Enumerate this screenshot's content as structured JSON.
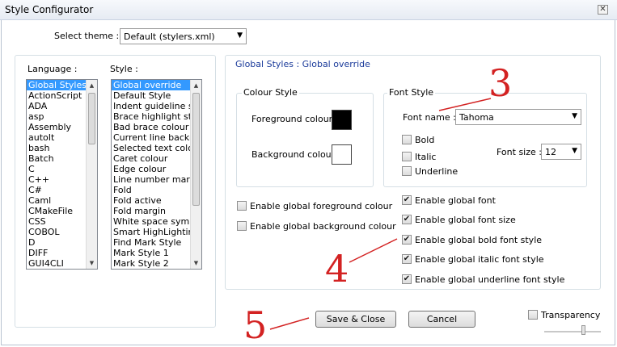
{
  "window": {
    "title": "Style Configurator",
    "close_icon": "close-icon"
  },
  "theme": {
    "label": "Select theme :",
    "value": "Default (stylers.xml)"
  },
  "language_list": {
    "header": "Language :",
    "items": [
      "Global Styles",
      "ActionScript",
      "ADA",
      "asp",
      "Assembly",
      "autoIt",
      "bash",
      "Batch",
      "C",
      "C++",
      "C#",
      "Caml",
      "CMakeFile",
      "CSS",
      "COBOL",
      "D",
      "DIFF",
      "GUI4CLI"
    ],
    "selected": "Global Styles"
  },
  "style_list": {
    "header": "Style :",
    "items": [
      "Global override",
      "Default Style",
      "Indent guideline sty",
      "Brace highlight style",
      "Bad brace colour",
      "Current line backgr",
      "Selected text colou",
      "Caret colour",
      "Edge colour",
      "Line number margin",
      "Fold",
      "Fold active",
      "Fold margin",
      "White space symbo",
      "Smart HighLighting",
      "Find Mark Style",
      "Mark Style 1",
      "Mark Style 2"
    ],
    "selected": "Global override"
  },
  "breadcrumb": "Global Styles : Global override",
  "colour_style": {
    "title": "Colour Style",
    "foreground_label": "Foreground colour",
    "foreground_color": "#000000",
    "background_label": "Background colour",
    "background_color": "#ffffff"
  },
  "font_style": {
    "title": "Font Style",
    "font_name_label": "Font name :",
    "font_name": "Tahoma",
    "bold": "Bold",
    "italic": "Italic",
    "underline": "Underline",
    "font_size_label": "Font size :",
    "font_size": "12"
  },
  "global_options": {
    "enable_fg": "Enable global foreground colour",
    "enable_bg": "Enable global background colour",
    "enable_font": "Enable global font",
    "enable_font_size": "Enable global font size",
    "enable_bold": "Enable global bold font style",
    "enable_italic": "Enable global italic font style",
    "enable_underline": "Enable global underline font style"
  },
  "buttons": {
    "save": "Save & Close",
    "cancel": "Cancel"
  },
  "transparency": {
    "label": "Transparency"
  },
  "annotations": {
    "three": "3",
    "four": "4",
    "five": "5",
    "color": "#d32222"
  }
}
